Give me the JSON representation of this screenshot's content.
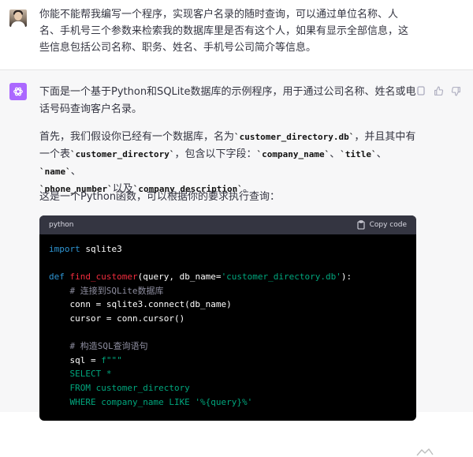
{
  "user": {
    "message": "你能不能帮我编写一个程序，实现客户名录的随时查询，可以通过单位名称、人名、手机号三个参数来检索我的数据库里是否有这个人，如果有显示全部信息，这些信息包括公司名称、职务、姓名、手机号公司简介等信息。"
  },
  "assistant": {
    "intro": "下面是一个基于Python和SQLite数据库的示例程序，用于通过公司名称、姓名或电话号码查询客户名录。",
    "para2": {
      "t1": "首先，我们假设你已经有一个数据库，名为",
      "c1": "`customer_directory.db`",
      "t2": "，并且其中有一个表",
      "c2": "`customer_directory`",
      "t3": "，包含以下字段：",
      "c3": "`company_name`",
      "t4": "、",
      "c4": "`title`",
      "t5": "、",
      "c5": "`name`",
      "t6": "、",
      "c6": "`phone_number`",
      "t7": "以及",
      "c7": "`company_description`",
      "t8": "。"
    },
    "para3": "这是一个Python函数，可以根据你的要求执行查询："
  },
  "code_block": {
    "language": "python",
    "copy_label": "Copy code",
    "lines": {
      "l1_kw": "import",
      "l1_rest": " sqlite3",
      "l3_kw": "def",
      "l3_fn": "find_customer",
      "l3_a": "(query, db_name=",
      "l3_str": "'customer_directory.db'",
      "l3_b": "):",
      "l4_cm": "    # 连接到SQLite数据库",
      "l5": "    conn = sqlite3.connect(db_name)",
      "l6": "    cursor = conn.cursor()",
      "l8_cm": "    # 构造SQL查询语句",
      "l9_a": "    sql = ",
      "l9_str": "f\"\"\"",
      "l10_str": "    SELECT *",
      "l11_str": "    FROM customer_directory",
      "l12_str": "    WHERE company_name LIKE '%{query}%'"
    }
  },
  "colors": {
    "accent_purple": "#ab68ff",
    "code_bg": "#000000",
    "code_header": "#343541",
    "keyword": "#2e95d3",
    "function": "#f22c3d",
    "string": "#00a67d",
    "comment": "#8e8ea0"
  },
  "icons": [
    "user-avatar",
    "chatgpt-logo-icon",
    "copy-icon",
    "thumbs-up-icon",
    "thumbs-down-icon",
    "clipboard-icon"
  ]
}
